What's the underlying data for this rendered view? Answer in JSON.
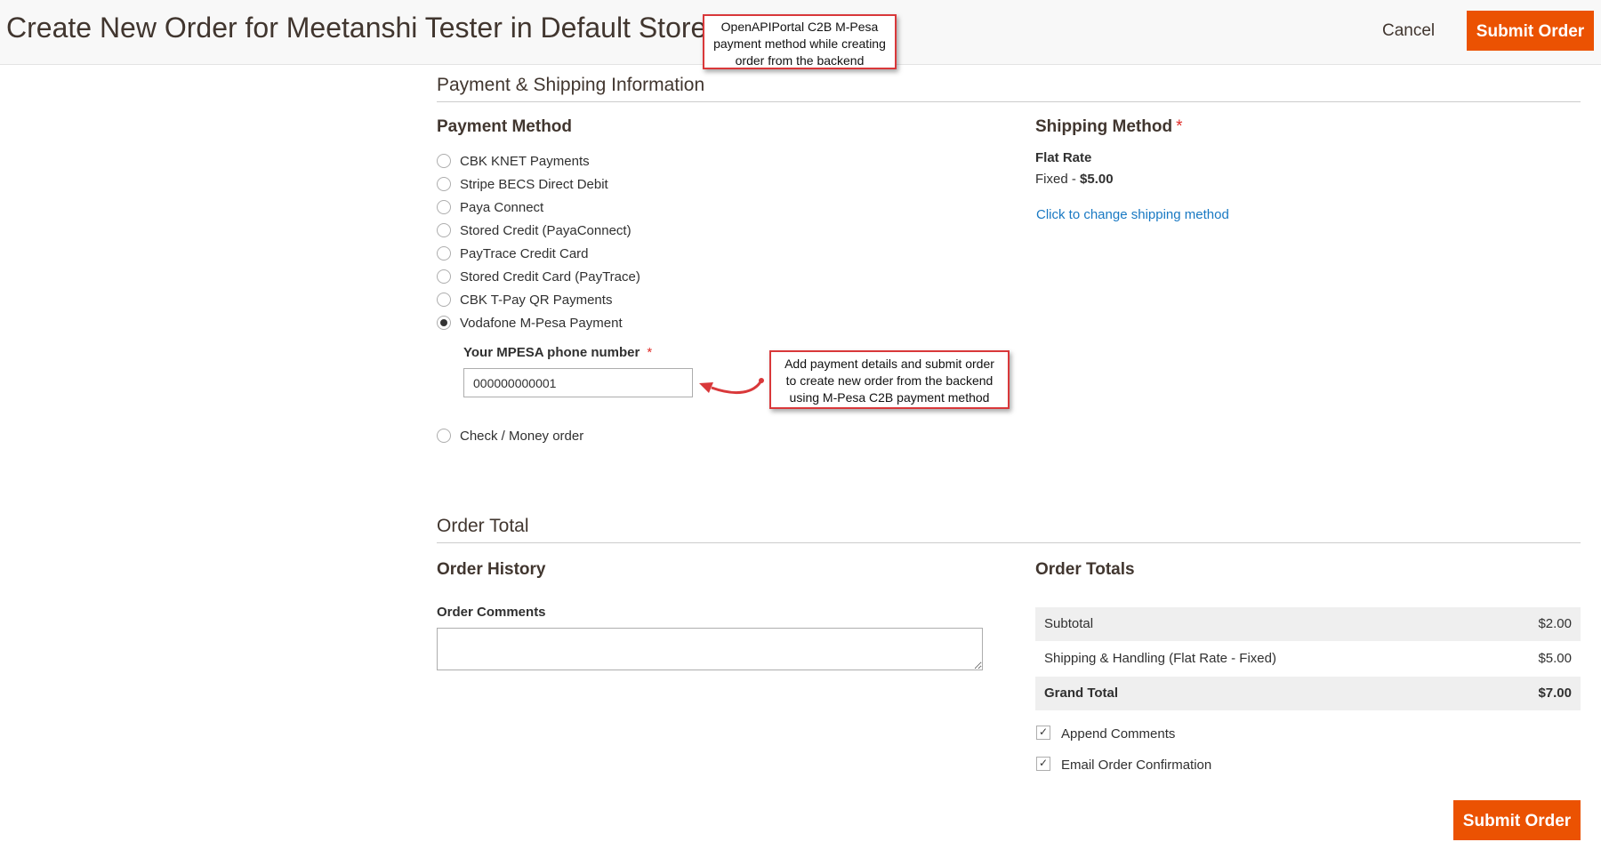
{
  "header": {
    "title": "Create New Order for Meetanshi Tester in Default Store View",
    "cancel_label": "Cancel",
    "submit_label": "Submit Order"
  },
  "callouts": {
    "top": [
      "OpenAPIPortal C2B M-Pesa",
      "payment method while creating",
      "order from the backend"
    ],
    "side": [
      "Add payment details and submit order",
      "to create new order from the backend",
      "using M-Pesa C2B payment method"
    ]
  },
  "payment_shipping": {
    "section_title": "Payment & Shipping Information",
    "payment_method_title": "Payment Method",
    "methods": [
      {
        "label": "CBK KNET Payments",
        "selected": false
      },
      {
        "label": "Stripe BECS Direct Debit",
        "selected": false
      },
      {
        "label": "Paya Connect",
        "selected": false
      },
      {
        "label": "Stored Credit (PayaConnect)",
        "selected": false
      },
      {
        "label": "PayTrace Credit Card",
        "selected": false
      },
      {
        "label": "Stored Credit Card (PayTrace)",
        "selected": false
      },
      {
        "label": "CBK T-Pay QR Payments",
        "selected": false
      },
      {
        "label": "Vodafone M-Pesa Payment",
        "selected": true
      },
      {
        "label": "Check / Money order",
        "selected": false
      }
    ],
    "mpesa_label": "Your MPESA phone number",
    "mpesa_required": "*",
    "mpesa_value": "000000000001",
    "shipping_method_title": "Shipping Method",
    "shipping_required": "*",
    "carrier": "Flat Rate",
    "rate_prefix": "Fixed - ",
    "rate_price": "$5.00",
    "change_link": "Click to change shipping method"
  },
  "order_total": {
    "section_title": "Order Total",
    "history_title": "Order History",
    "comments_label": "Order Comments",
    "comments_value": "",
    "totals_title": "Order Totals",
    "rows": [
      {
        "label": "Subtotal",
        "value": "$2.00"
      },
      {
        "label": "Shipping & Handling (Flat Rate - Fixed)",
        "value": "$5.00"
      },
      {
        "label": "Grand Total",
        "value": "$7.00"
      }
    ],
    "append_comments_label": "Append Comments",
    "append_comments_checked": true,
    "email_confirmation_label": "Email Order Confirmation",
    "email_confirmation_checked": true
  },
  "colors": {
    "accent": "#eb5202",
    "link": "#1979c3",
    "required": "#e02b27",
    "callout_border": "#d9383a"
  }
}
